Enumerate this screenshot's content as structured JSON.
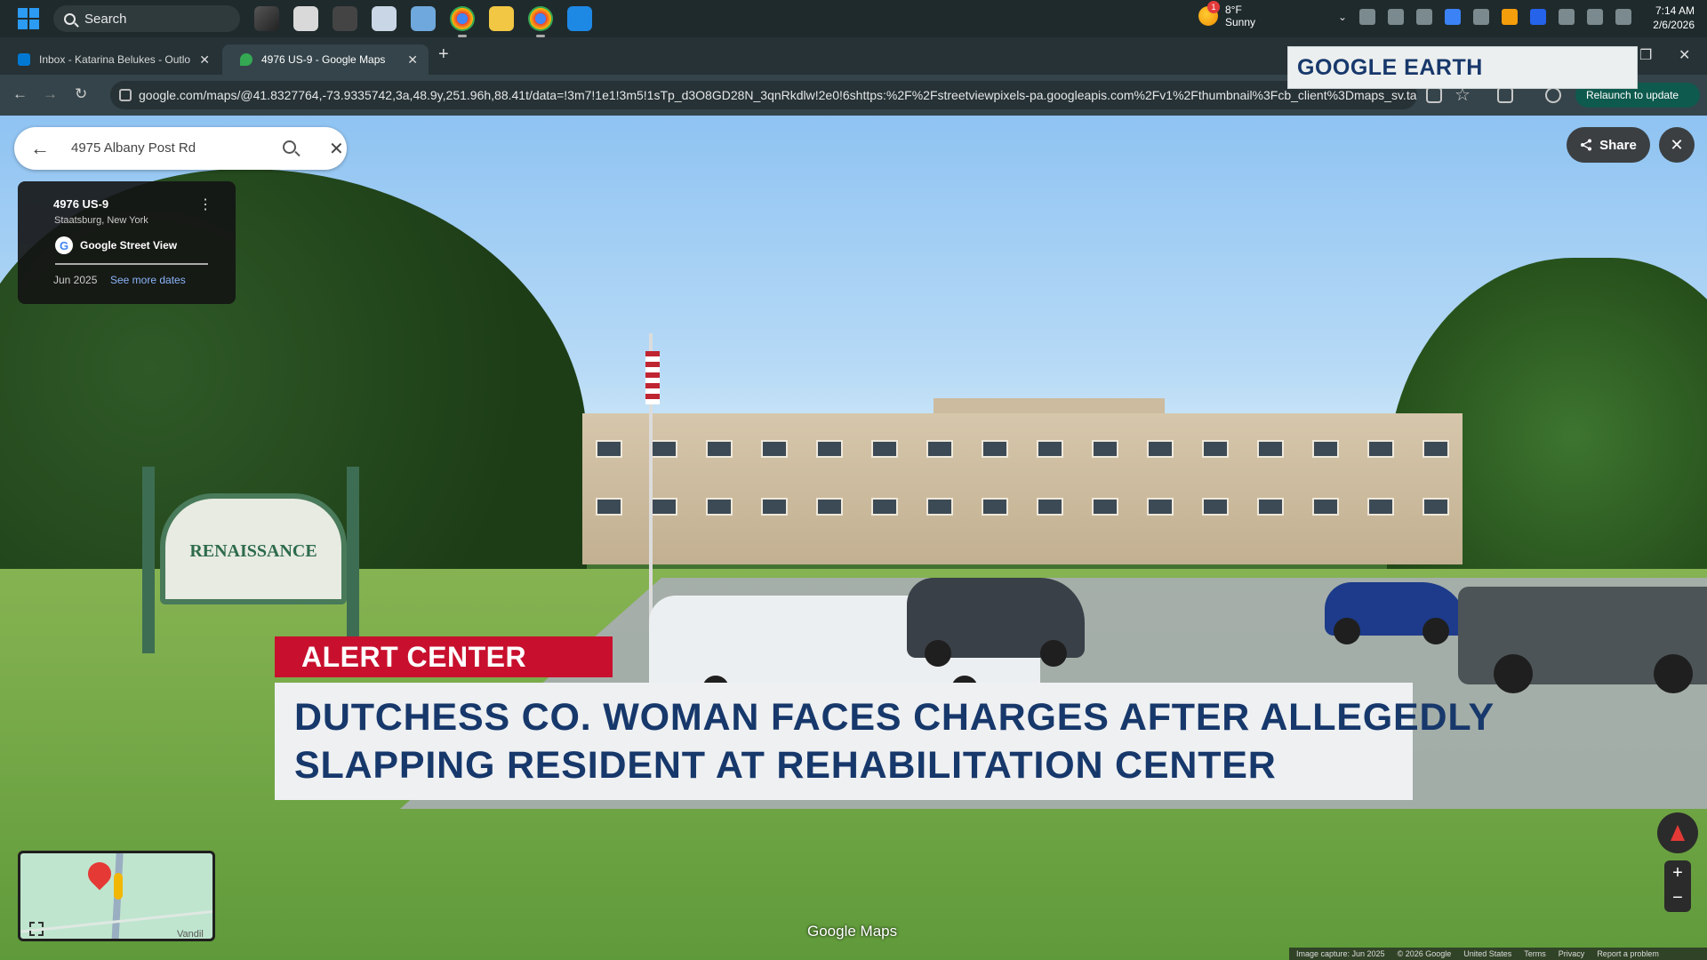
{
  "taskbar": {
    "search_label": "Search",
    "weather_temp": "8°F",
    "weather_cond": "Sunny",
    "weather_badge": "1",
    "time": "7:14 AM",
    "date": "2/6/2026"
  },
  "browser": {
    "tabs": [
      {
        "label": "Inbox - Katarina Belukes - Outlo",
        "icon": "outlook-icon"
      },
      {
        "label": "4976 US-9 - Google Maps",
        "icon": "maps-icon"
      }
    ],
    "url": "google.com/maps/@41.8327764,-73.9335742,3a,48.9y,251.96h,88.41t/data=!3m7!1e1!3m5!1sTp_d3O8GD28N_3qnRkdlw!2e0!6shttps:%2F%2Fstreetviewpixels-pa.googleapis.com%2Fv1%2Fthumbnail%3Fcb_client%3Dmaps_sv.tactil...",
    "relaunch_label": "Relaunch to update"
  },
  "overlay": {
    "google_earth_label": "GOOGLE EARTH"
  },
  "maps": {
    "search_value": "4975 Albany Post Rd",
    "place_title": "4976 US-9",
    "place_subtitle": "Staatsburg, New York",
    "source": "Google Street View",
    "capture_date": "Jun 2025",
    "see_more_dates": "See more dates",
    "share_label": "Share",
    "minimap_label": "Vandil",
    "watermark": "Google Maps",
    "footer": {
      "capture": "Image capture: Jun 2025",
      "copyright": "© 2026 Google",
      "region": "United States",
      "terms": "Terms",
      "privacy": "Privacy",
      "report": "Report a problem"
    }
  },
  "scene": {
    "sign_text": "RENAISSANCE"
  },
  "news": {
    "tag": "ALERT CENTER",
    "headline_line1": "DUTCHESS CO. WOMAN FACES CHARGES AFTER ALLEGEDLY",
    "headline_line2": "SLAPPING RESIDENT AT REHABILITATION CENTER"
  },
  "colors": {
    "alert_red": "#c8102e",
    "headline_navy": "#17386b",
    "maps_link": "#8ab4f8"
  }
}
